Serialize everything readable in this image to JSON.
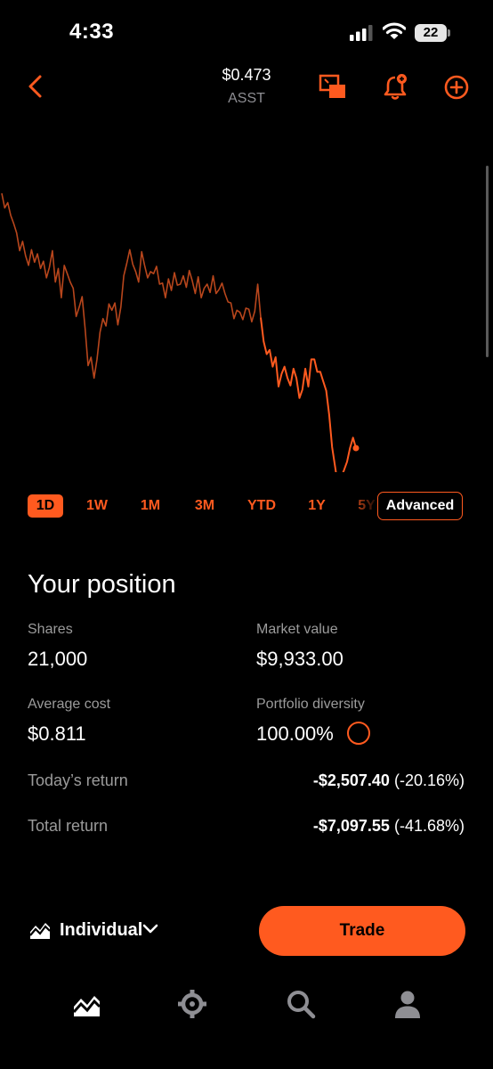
{
  "status_bar": {
    "time": "4:33",
    "battery": "22"
  },
  "header": {
    "price": "$0.473",
    "ticker": "ASST"
  },
  "chart_data": {
    "type": "line",
    "x": [
      1,
      2,
      3,
      4,
      5,
      6,
      7,
      8,
      9,
      10,
      11,
      12,
      13,
      14,
      15,
      16,
      17,
      18,
      19,
      20,
      21,
      22,
      23,
      24,
      25,
      26,
      27,
      28,
      29,
      30,
      31,
      32,
      33,
      34,
      35,
      36,
      37,
      38,
      39,
      40,
      41,
      42,
      43,
      44,
      45,
      46,
      47,
      48,
      49,
      50,
      51,
      52,
      53,
      54,
      55,
      56,
      57,
      58,
      59,
      60,
      61,
      62,
      63,
      64,
      65,
      66,
      67,
      68,
      69,
      70,
      71,
      72,
      73,
      74,
      75,
      76,
      77,
      78,
      79,
      80,
      81,
      82,
      83,
      84,
      85,
      86,
      87,
      88,
      89,
      90,
      91,
      92,
      93,
      94,
      95,
      96,
      97,
      98,
      99,
      100,
      101,
      102,
      103,
      104,
      105,
      106,
      107,
      108,
      109,
      110,
      111,
      112,
      113,
      114,
      115,
      116,
      117,
      118,
      119,
      120
    ],
    "values": [
      0.617,
      0.603,
      0.608,
      0.596,
      0.588,
      0.579,
      0.562,
      0.571,
      0.557,
      0.548,
      0.563,
      0.551,
      0.559,
      0.545,
      0.552,
      0.536,
      0.546,
      0.562,
      0.532,
      0.545,
      0.517,
      0.548,
      0.54,
      0.532,
      0.526,
      0.499,
      0.508,
      0.518,
      0.488,
      0.452,
      0.46,
      0.44,
      0.458,
      0.484,
      0.497,
      0.49,
      0.511,
      0.505,
      0.512,
      0.491,
      0.508,
      0.538,
      0.55,
      0.563,
      0.549,
      0.542,
      0.532,
      0.561,
      0.548,
      0.536,
      0.542,
      0.54,
      0.547,
      0.53,
      0.531,
      0.517,
      0.535,
      0.524,
      0.541,
      0.529,
      0.53,
      0.538,
      0.527,
      0.543,
      0.533,
      0.521,
      0.537,
      0.517,
      0.526,
      0.53,
      0.522,
      0.538,
      0.521,
      0.525,
      0.531,
      0.521,
      0.513,
      0.512,
      0.497,
      0.505,
      0.503,
      0.496,
      0.507,
      0.506,
      0.494,
      0.504,
      0.53,
      0.498,
      0.475,
      0.463,
      0.467,
      0.451,
      0.46,
      0.432,
      0.444,
      0.451,
      0.44,
      0.433,
      0.449,
      0.44,
      0.421,
      0.429,
      0.449,
      0.432,
      0.458,
      0.458,
      0.446,
      0.446,
      0.437,
      0.428,
      0.405,
      0.374,
      0.355,
      0.336,
      0.345,
      0.352,
      0.36,
      0.373,
      0.383,
      0.373
    ],
    "ylim": [
      0.35,
      0.64
    ],
    "color": "#ff5a1f",
    "grid": false
  },
  "ranges": [
    {
      "label": "1D",
      "active": true
    },
    {
      "label": "1W",
      "active": false
    },
    {
      "label": "1M",
      "active": false
    },
    {
      "label": "3M",
      "active": false
    },
    {
      "label": "YTD",
      "active": false
    },
    {
      "label": "1Y",
      "active": false
    },
    {
      "label": "5Y",
      "active": false
    }
  ],
  "advanced_label": "Advanced",
  "position": {
    "title": "Your position",
    "shares_label": "Shares",
    "shares": "21,000",
    "market_value_label": "Market value",
    "market_value": "$9,933.00",
    "avg_cost_label": "Average cost",
    "avg_cost": "$0.811",
    "diversity_label": "Portfolio diversity",
    "diversity": "100.00%",
    "today_label": "Today’s return",
    "today_amount": "-$2,507.40",
    "today_pct": "(-20.16%)",
    "total_label": "Total return",
    "total_amount": "-$7,097.55",
    "total_pct": "(-41.68%)"
  },
  "bottom": {
    "account": "Individual",
    "trade": "Trade"
  },
  "tabs": [
    {
      "name": "investing",
      "icon": "chart-icon"
    },
    {
      "name": "crypto",
      "icon": "crypto-icon"
    },
    {
      "name": "search",
      "icon": "search-icon"
    },
    {
      "name": "account",
      "icon": "person-icon"
    }
  ],
  "colors": {
    "accent": "#ff5a1f",
    "background": "#000000",
    "muted": "#9b9b9b"
  }
}
